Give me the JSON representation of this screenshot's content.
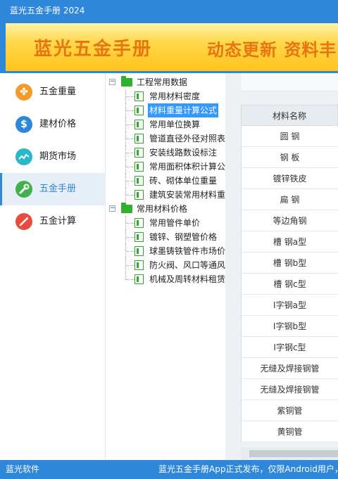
{
  "window": {
    "title": "蓝光五金手册 2024"
  },
  "banner": {
    "title": "蓝光五金手册",
    "slogan": "动态更新 资料丰"
  },
  "sidebar": {
    "items": [
      {
        "label": "五金重量",
        "icon": "cross-flower-icon",
        "color": "#f39a2a",
        "active": false
      },
      {
        "label": "建材价格",
        "icon": "dollar-icon",
        "color": "#2e87d8",
        "active": false
      },
      {
        "label": "期货市场",
        "icon": "trend-line-icon",
        "color": "#29b7cc",
        "active": false
      },
      {
        "label": "五金手册",
        "icon": "wrench-icon",
        "color": "#3fb24a",
        "active": true
      },
      {
        "label": "五金计算",
        "icon": "magic-wand-icon",
        "color": "#e84b3c",
        "active": false
      }
    ]
  },
  "tree": {
    "groups": [
      {
        "label": "工程常用数据",
        "toggle": "−",
        "items": [
          {
            "label": "常用材料密度",
            "selected": false
          },
          {
            "label": "材料重量计算公式",
            "selected": true
          },
          {
            "label": "常用单位换算",
            "selected": false
          },
          {
            "label": "管道直径外径对照表",
            "selected": false
          },
          {
            "label": "安装线路数设标注",
            "selected": false
          },
          {
            "label": "常用面积体积计算公",
            "selected": false
          },
          {
            "label": "砖、砌体单位重量",
            "selected": false
          },
          {
            "label": "建筑安装常用材料重",
            "selected": false
          }
        ]
      },
      {
        "label": "常用材料价格",
        "toggle": "−",
        "items": [
          {
            "label": "常用管件单价",
            "selected": false
          },
          {
            "label": "镀锌、钢塑管价格",
            "selected": false
          },
          {
            "label": "球墨铸铁管件市场价",
            "selected": false
          },
          {
            "label": "防火阀、风口等通风",
            "selected": false
          },
          {
            "label": "机械及周转材料租赁",
            "selected": false
          }
        ]
      }
    ]
  },
  "table": {
    "header": "材料名称",
    "rows": [
      "圆  钢",
      "钢  板",
      "镀锌铁皮",
      "扁  钢",
      "等边角钢",
      "槽  钢a型",
      "槽  钢b型",
      "槽  钢c型",
      "I字钢a型",
      "I字钢b型",
      "I字钢c型",
      "无缝及焊接钢管",
      "无缝及焊接钢管",
      "紫铜管",
      "黄铜管"
    ]
  },
  "status": {
    "left": "蓝光软件",
    "right": "蓝光五金手册App正式发布，仅限Android用户，"
  },
  "colors": {
    "accent": "#2e87d8",
    "selection": "#3399ff",
    "folder": "#2fb02f"
  }
}
